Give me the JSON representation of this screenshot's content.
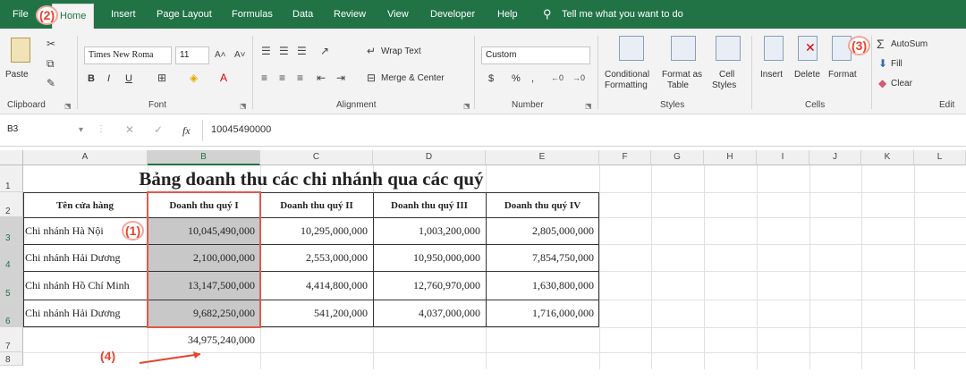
{
  "ribbon_tabs": [
    "File",
    "Home",
    "Insert",
    "Page Layout",
    "Formulas",
    "Data",
    "Review",
    "View",
    "Developer",
    "Help"
  ],
  "tell_me": "Tell me what you want to do",
  "ribbon": {
    "clipboard": {
      "paste": "Paste",
      "label": "Clipboard"
    },
    "font": {
      "name": "Times New Roma",
      "size": "11",
      "bold": "B",
      "italic": "I",
      "underline": "U",
      "label": "Font"
    },
    "alignment": {
      "wrap": "Wrap Text",
      "merge": "Merge & Center",
      "label": "Alignment"
    },
    "number": {
      "format": "Custom",
      "currency": "$",
      "percent": "%",
      "comma": ",",
      "label": "Number"
    },
    "styles": {
      "cond": "Conditional",
      "cond2": "Formatting",
      "fmt_table": "Format as",
      "fmt_table2": "Table",
      "cell_styles": "Cell",
      "cell_styles2": "Styles",
      "label": "Styles"
    },
    "cells": {
      "insert": "Insert",
      "delete": "Delete",
      "format": "Format",
      "label": "Cells"
    },
    "editing": {
      "autosum": "AutoSum",
      "fill": "Fill",
      "clear": "Clear",
      "label": "Edit"
    }
  },
  "formula_bar": {
    "name_box": "B3",
    "fx": "fx",
    "formula": "10045490000"
  },
  "columns": [
    "A",
    "B",
    "C",
    "D",
    "E",
    "F",
    "G",
    "H",
    "I",
    "J",
    "K",
    "L"
  ],
  "rows": [
    "1",
    "2",
    "3",
    "4",
    "5",
    "6",
    "7",
    "8"
  ],
  "sheet": {
    "title": "Bảng doanh thu các chi nhánh qua các quý",
    "headers": [
      "Tên cửa hàng",
      "Doanh thu quý I",
      "Doanh thu quý II",
      "Doanh thu quý III",
      "Doanh thu quý IV"
    ],
    "data": [
      [
        "Chi nhánh Hà Nội",
        "10,045,490,000",
        "10,295,000,000",
        "1,003,200,000",
        "2,805,000,000"
      ],
      [
        "Chi nhánh Hải Dương",
        "2,100,000,000",
        "2,553,000,000",
        "10,950,000,000",
        "7,854,750,000"
      ],
      [
        "Chi nhánh Hồ Chí Minh",
        "13,147,500,000",
        "4,414,800,000",
        "12,760,970,000",
        "1,630,800,000"
      ],
      [
        "Chi nhánh Hải Dương",
        "9,682,250,000",
        "541,200,000",
        "4,037,000,000",
        "1,716,000,000"
      ]
    ],
    "total": "34,975,240,000"
  },
  "callouts": [
    "(1)",
    "(2)",
    "(3)",
    "(4)"
  ],
  "colors": {
    "excel_green": "#217346",
    "callout_red": "#e8432e",
    "selection_gray": "#c8c8c8"
  }
}
